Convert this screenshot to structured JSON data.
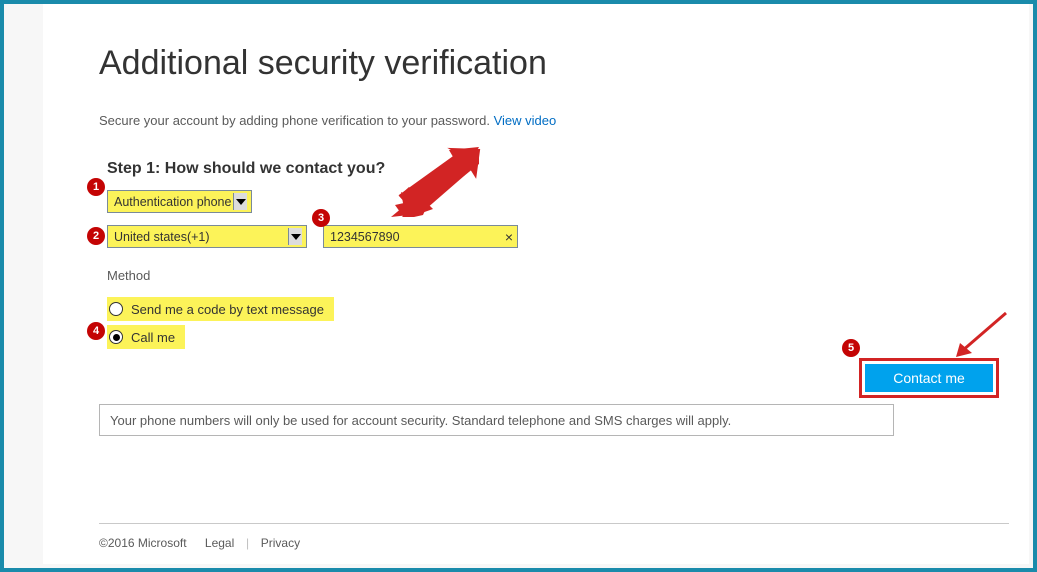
{
  "title": "Additional security verification",
  "subtext": "Secure your account by adding phone verification to your password.",
  "videoLinkText": "View video",
  "stepTitle": "Step 1: How should we contact you?",
  "authPhoneSelect": "Authentication phone",
  "countrySelect": "United states(+1)",
  "phoneNumber": "1234567890",
  "methodLabel": "Method",
  "methodText": "Send me a code by text message",
  "methodCall": "Call me",
  "contactBtn": "Contact me",
  "notice": "Your phone numbers will only be used for account security. Standard telephone and SMS charges will apply.",
  "footer": {
    "copyright": "©2016 Microsoft",
    "legal": "Legal",
    "privacy": "Privacy"
  },
  "badges": {
    "b1": "1",
    "b2": "2",
    "b3": "3",
    "b4": "4",
    "b5": "5"
  }
}
